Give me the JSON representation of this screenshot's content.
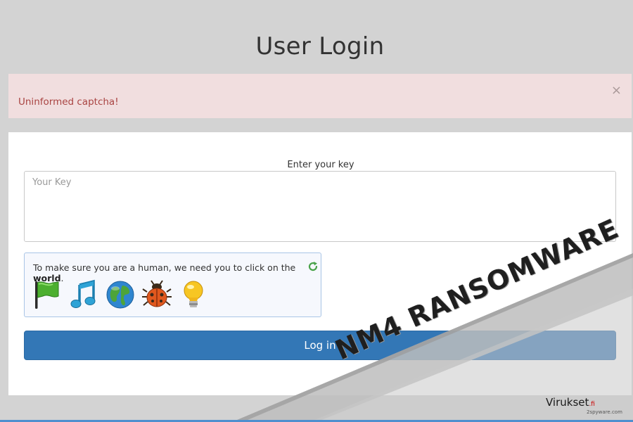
{
  "page": {
    "title": "User Login"
  },
  "alert": {
    "message": "Uninformed captcha!",
    "close_label": "×"
  },
  "form": {
    "key_label": "Enter your key",
    "key_placeholder": "Your Key",
    "key_value": ""
  },
  "captcha": {
    "prompt_prefix": "To make sure you are a human, we need you to click on the ",
    "prompt_target": "world",
    "prompt_suffix": ".",
    "refresh_icon": "refresh-icon",
    "options": [
      {
        "icon": "flag-icon",
        "color": "#3a9a2e"
      },
      {
        "icon": "music-note-icon",
        "color": "#2a8fc0"
      },
      {
        "icon": "globe-icon",
        "color": "#2f7fc6"
      },
      {
        "icon": "bug-icon",
        "color": "#d2521c"
      },
      {
        "icon": "lightbulb-icon",
        "color": "#f2c21b"
      }
    ]
  },
  "login_button": {
    "label": "Log in",
    "color": "#3377b6"
  },
  "watermark": {
    "text": "NM4 RANSOMWARE",
    "brand": "Virukset",
    "brand_tld": ".fi",
    "brand_sub": "2spyware.com"
  }
}
